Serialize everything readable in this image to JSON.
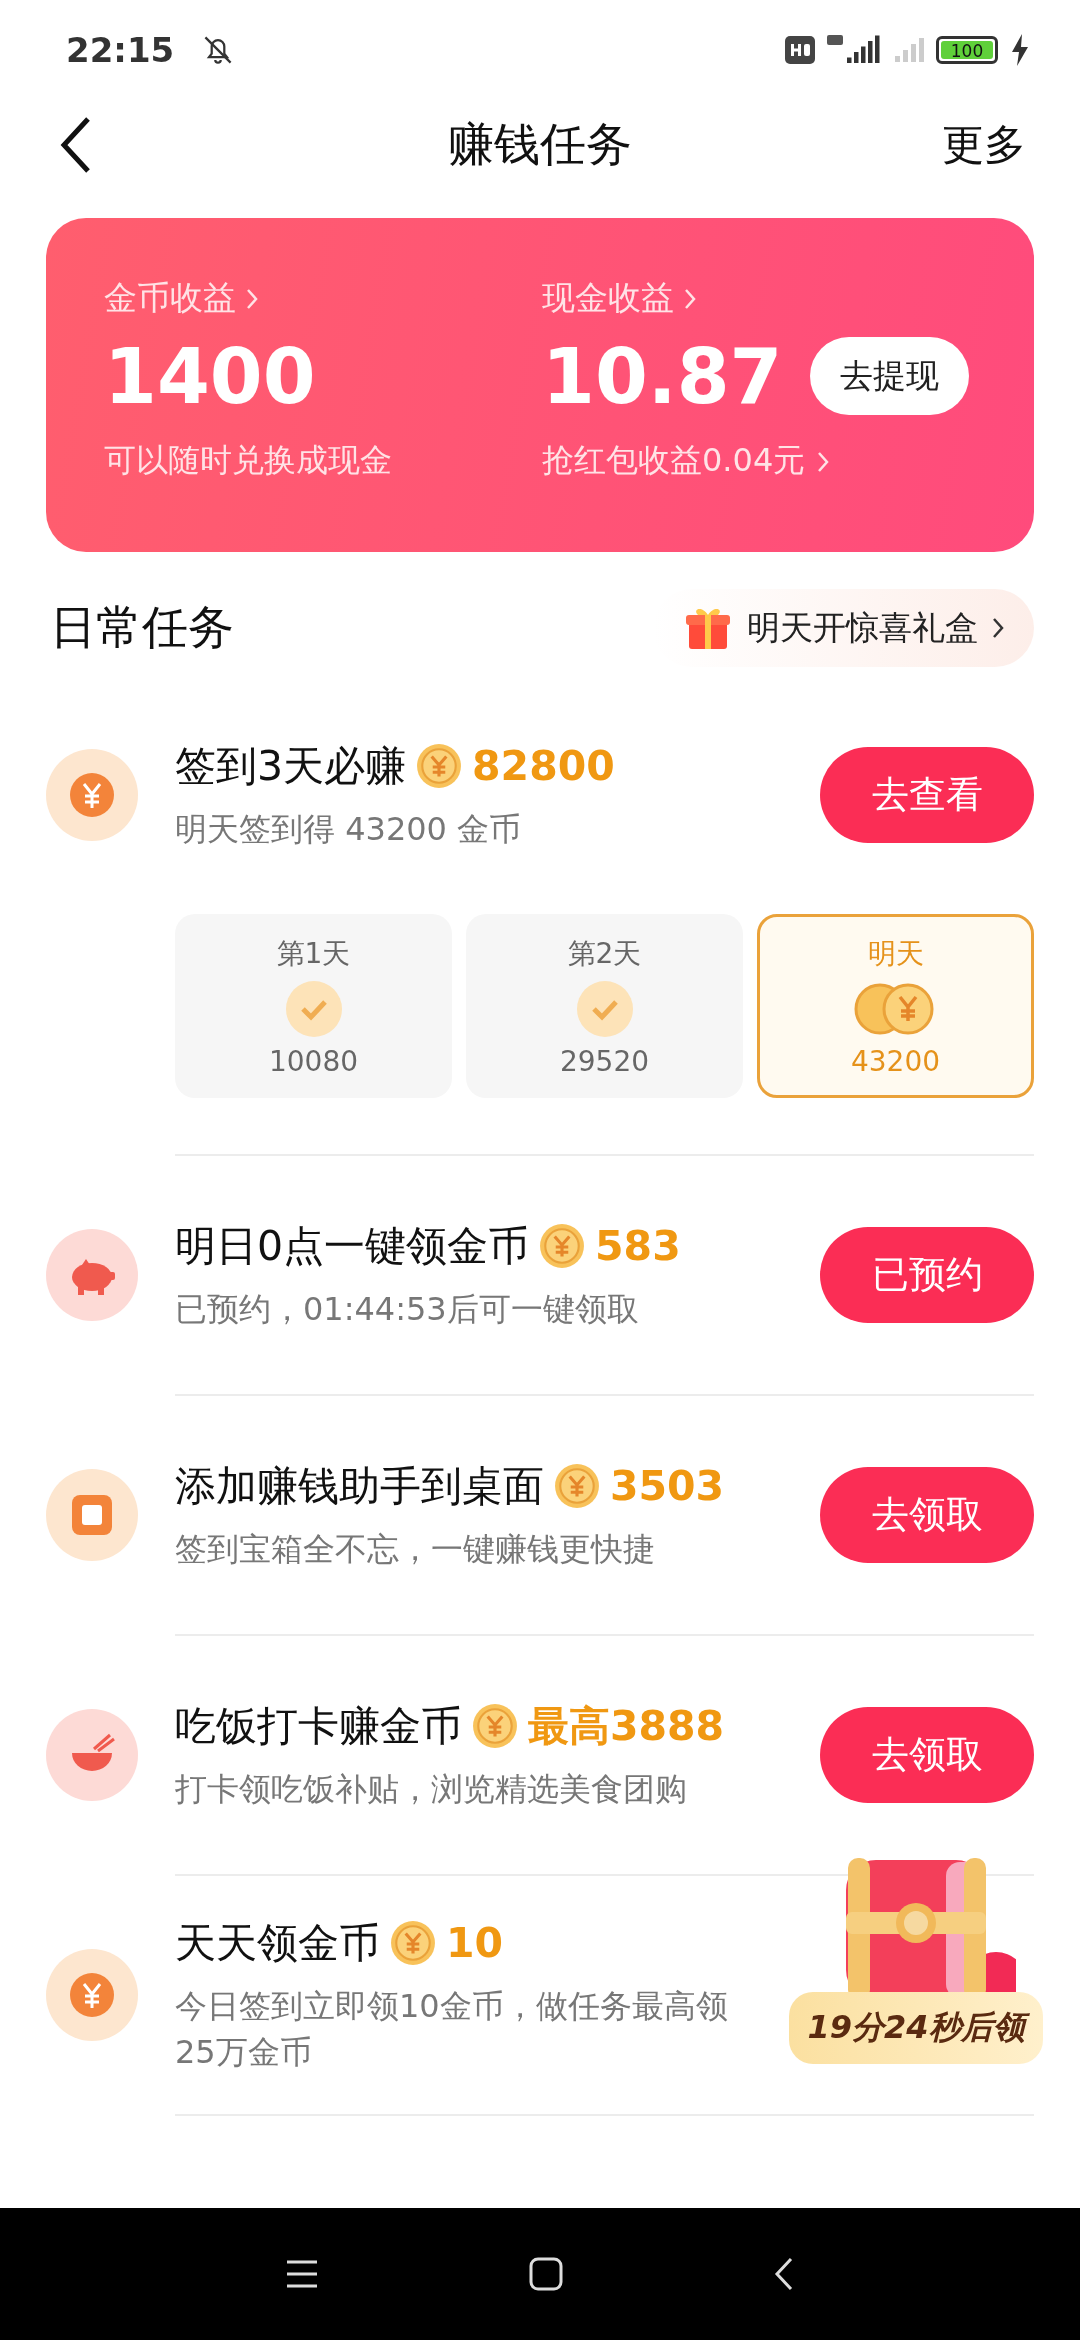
{
  "status_bar": {
    "time": "22:15",
    "battery": "100"
  },
  "nav": {
    "title": "赚钱任务",
    "more": "更多"
  },
  "earnings": [
    {
      "label": "金币收益",
      "value": "1400",
      "note": "可以随时兑换成现金",
      "note_link": false
    },
    {
      "label": "现金收益",
      "value": "10.87",
      "note": "抢红包收益0.04元",
      "note_link": true,
      "action": "去提现"
    }
  ],
  "section": {
    "title": "日常任务",
    "gift": "明天开惊喜礼盒"
  },
  "tasks": [
    {
      "kind": "coin",
      "title": "签到3天必赚",
      "reward": "82800",
      "subtitle": "明天签到得 43200 金币",
      "button": "去查看",
      "days": [
        {
          "label": "第1天",
          "amount": "10080",
          "selected": false
        },
        {
          "label": "第2天",
          "amount": "29520",
          "selected": false
        },
        {
          "label": "明天",
          "amount": "43200",
          "selected": true
        }
      ]
    },
    {
      "kind": "piggy",
      "title": "明日0点一键领金币",
      "reward": "583",
      "subtitle": "已预约，01:44:53后可一键领取",
      "button": "已预约"
    },
    {
      "kind": "square",
      "title": "添加赚钱助手到桌面",
      "reward": "3503",
      "subtitle": "签到宝箱全不忘，一键赚钱更快捷",
      "button": "去领取"
    },
    {
      "kind": "bowl",
      "title": "吃饭打卡赚金币",
      "reward": "最高3888",
      "subtitle": "打卡领吃饭补贴，浏览精选美食团购",
      "button": "去领取"
    },
    {
      "kind": "coin",
      "title": "天天领金币",
      "reward": "10",
      "subtitle": "今日签到立即领10金币，做任务最高领25万金币"
    }
  ],
  "chest": {
    "label": "19分24秒后领"
  }
}
